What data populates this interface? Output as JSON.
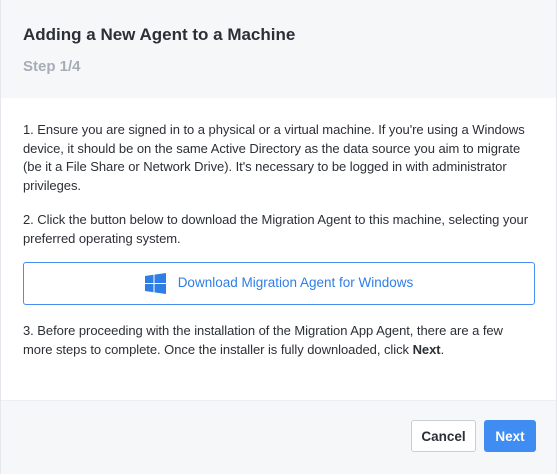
{
  "header": {
    "title": "Adding a New Agent to a Machine",
    "step": "Step 1/4"
  },
  "body": {
    "paragraph1": "1. Ensure you are signed in to a physical or a virtual machine. If you're using a Windows device, it should be on the same Active Directory as the data source you aim to migrate (be it a File Share or Network Drive). It's necessary to be logged in with administrator privileges.",
    "paragraph2": "2. Click the button below to download the Migration Agent to this machine, selecting your preferred operating system.",
    "download_button_label": "Download Migration Agent for Windows",
    "download_button_icon": "windows-logo-icon",
    "paragraph3_prefix": "3. Before proceeding with the installation of the Migration App Agent, there are a few more steps to complete. Once the installer is fully downloaded, click ",
    "paragraph3_bold": "Next",
    "paragraph3_suffix": "."
  },
  "footer": {
    "cancel_label": "Cancel",
    "next_label": "Next"
  },
  "colors": {
    "accent": "#3f8cf3",
    "link": "#2f7ee6",
    "header_bg": "#f6f7f9",
    "muted_text": "#a7adb6",
    "text": "#2b2f36"
  }
}
